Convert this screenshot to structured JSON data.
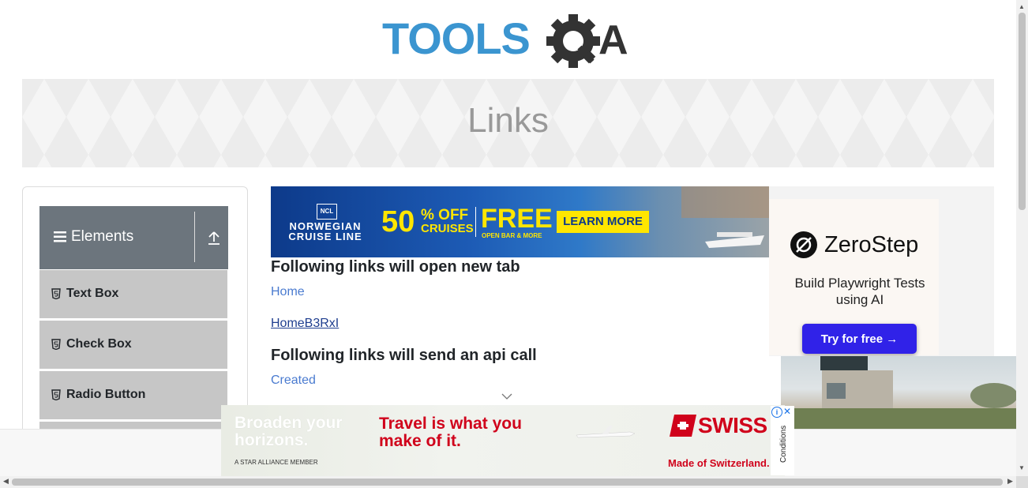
{
  "header": {
    "logo_text": "TOOLSQA",
    "logo_colors": {
      "tools": "#3b95d0",
      "qa": "#333333"
    }
  },
  "page": {
    "title": "Links"
  },
  "sidebar": {
    "group": {
      "label": "Elements",
      "icon": "menu-icon",
      "toggle_icon": "collapse-up-icon"
    },
    "items": [
      {
        "label": "Text Box",
        "icon": "html5-icon"
      },
      {
        "label": "Check Box",
        "icon": "html5-icon"
      },
      {
        "label": "Radio Button",
        "icon": "html5-icon"
      }
    ]
  },
  "ads": {
    "ncl": {
      "brand_line1": "NORWEGIAN",
      "brand_line2": "CRUISE LINE",
      "badge": "NCL",
      "offer_pct": "50",
      "offer_pct_suffix": "% OFF",
      "offer_pct_sub": "CRUISES",
      "offer_free": "FREE",
      "offer_free_sub": "OPEN BAR & MORE",
      "cta": "LEARN MORE"
    },
    "zerostep": {
      "name": "ZeroStep",
      "tagline": "Build Playwright Tests using AI",
      "cta": "Try for free →"
    },
    "swiss": {
      "left_line": "Broaden your horizons.",
      "member": "A STAR ALLIANCE MEMBER",
      "right_line": "Travel is what you make of it.",
      "brand": "SWISS",
      "made": "Made of Switzerland.",
      "conditions": "Conditions"
    }
  },
  "content": {
    "section1_heading": "Following links will open new tab",
    "link_home": "Home",
    "link_dynamic": "HomeB3RxI",
    "section2_heading": "Following links will send an api call",
    "link_created": "Created"
  },
  "colors": {
    "sidebar_header": "#6c757d",
    "sidebar_item": "#c6c6c6",
    "link": "#4a7bd0",
    "swiss_red": "#d0021b",
    "zerostep_button": "#3022e8"
  }
}
